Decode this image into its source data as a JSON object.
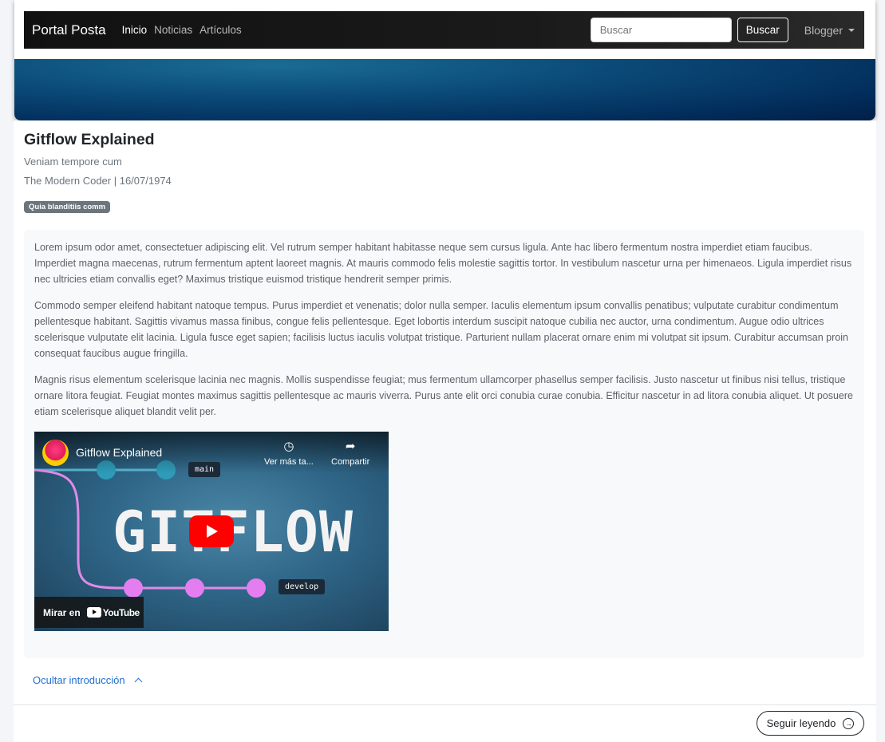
{
  "navbar": {
    "brand": "Portal Posta",
    "links": [
      {
        "label": "Inicio",
        "active": true
      },
      {
        "label": "Noticias",
        "active": false
      },
      {
        "label": "Artículos",
        "active": false
      }
    ],
    "search": {
      "placeholder": "Buscar",
      "button_label": "Buscar"
    },
    "user_menu": "Blogger"
  },
  "article": {
    "title": "Gitflow Explained",
    "subtitle": "Veniam tempore cum",
    "meta": "The Modern Coder | 16/07/1974",
    "tag": "Quia blanditiis comm",
    "paragraphs": [
      "Lorem ipsum odor amet, consectetuer adipiscing elit. Vel rutrum semper habitant habitasse neque sem cursus ligula. Ante hac libero fermentum nostra imperdiet etiam faucibus. Imperdiet magna maecenas, rutrum fermentum aptent laoreet magnis. At mauris commodo felis molestie sagittis tortor. In vestibulum nascetur urna per himenaeos. Ligula imperdiet risus nec ultricies etiam convallis eget? Maximus tristique euismod tristique hendrerit semper primis.",
      "Commodo semper eleifend habitant natoque tempus. Purus imperdiet et venenatis; dolor nulla semper. Iaculis elementum ipsum convallis penatibus; vulputate curabitur condimentum pellentesque habitant. Sagittis vivamus massa finibus, congue felis pellentesque. Eget lobortis interdum suscipit natoque cubilia nec auctor, urna condimentum. Augue odio ultrices scelerisque vulputate elit lacinia. Ligula fusce eget sapien; facilisis luctus iaculis volutpat tristique. Parturient nullam placerat ornare enim mi volutpat sit ipsum. Curabitur accumsan proin consequat faucibus augue fringilla.",
      "Magnis risus elementum scelerisque lacinia nec magnis. Mollis suspendisse feugiat; mus fermentum ullamcorper phasellus semper facilisis. Justo nascetur ut finibus nisi tellus, tristique ornare litora feugiat. Feugiat montes maximus sagittis pellentesque ac mauris viverra. Purus ante elit orci conubia curae conubia. Efficitur nascetur in ad litora conubia aliquet. Ut posuere etiam scelerisque aliquet blandit velit per."
    ],
    "video": {
      "title": "Gitflow Explained",
      "watch_later": "Ver más ta...",
      "share": "Compartir",
      "thumbnail_word": "GITFLOW",
      "branch_main": "main",
      "branch_develop": "develop",
      "watch_on": "Mirar en",
      "platform": "YouTube"
    },
    "toggle_label": "Ocultar introducción",
    "read_more": "Seguir leyendo"
  },
  "colors": {
    "link": "#1f6fd1",
    "tag_bg": "#6c757d",
    "banner": "#0b4a78",
    "play": "#ff0000"
  }
}
